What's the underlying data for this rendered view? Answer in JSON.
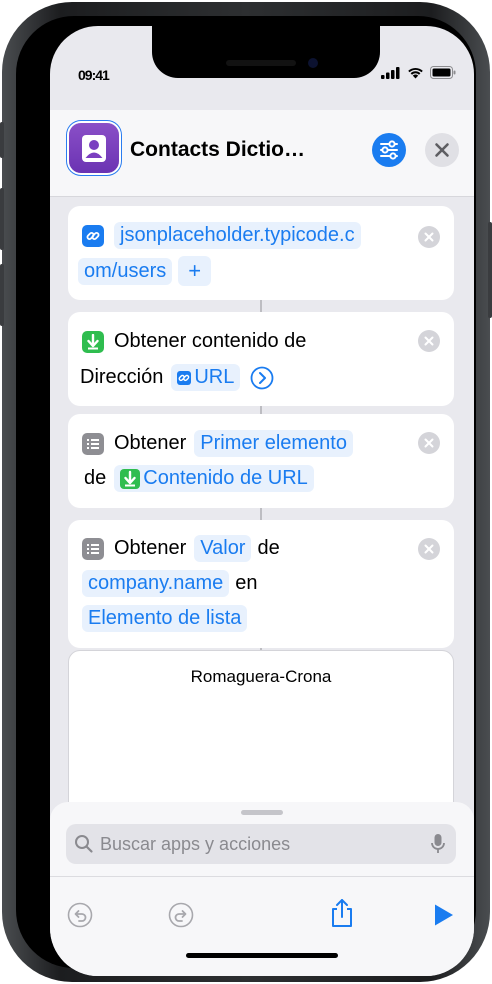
{
  "status": {
    "time": "09:41"
  },
  "header": {
    "title": "Contacts Dictio…"
  },
  "actions": {
    "url": {
      "line1": "jsonplaceholder.typicode.c",
      "line2": "om/users",
      "add": "+"
    },
    "get_contents": {
      "text1": "Obtener contenido de",
      "text2": "Dirección",
      "chip": "URL"
    },
    "get_item": {
      "text1": "Obtener",
      "chip1": "Primer elemento",
      "text2": "de",
      "chip2": "Contenido de URL"
    },
    "get_value": {
      "text1": "Obtener",
      "chip1": "Valor",
      "text2": "de",
      "chip2": "company.name",
      "text3": "en",
      "chip3": "Elemento de lista"
    }
  },
  "result": {
    "text": "Romaguera-Crona"
  },
  "search": {
    "placeholder": "Buscar apps y acciones"
  },
  "colors": {
    "accent": "#1a7cf0",
    "app_icon": "#7a3fc0",
    "download_green": "#2fbd4f"
  }
}
